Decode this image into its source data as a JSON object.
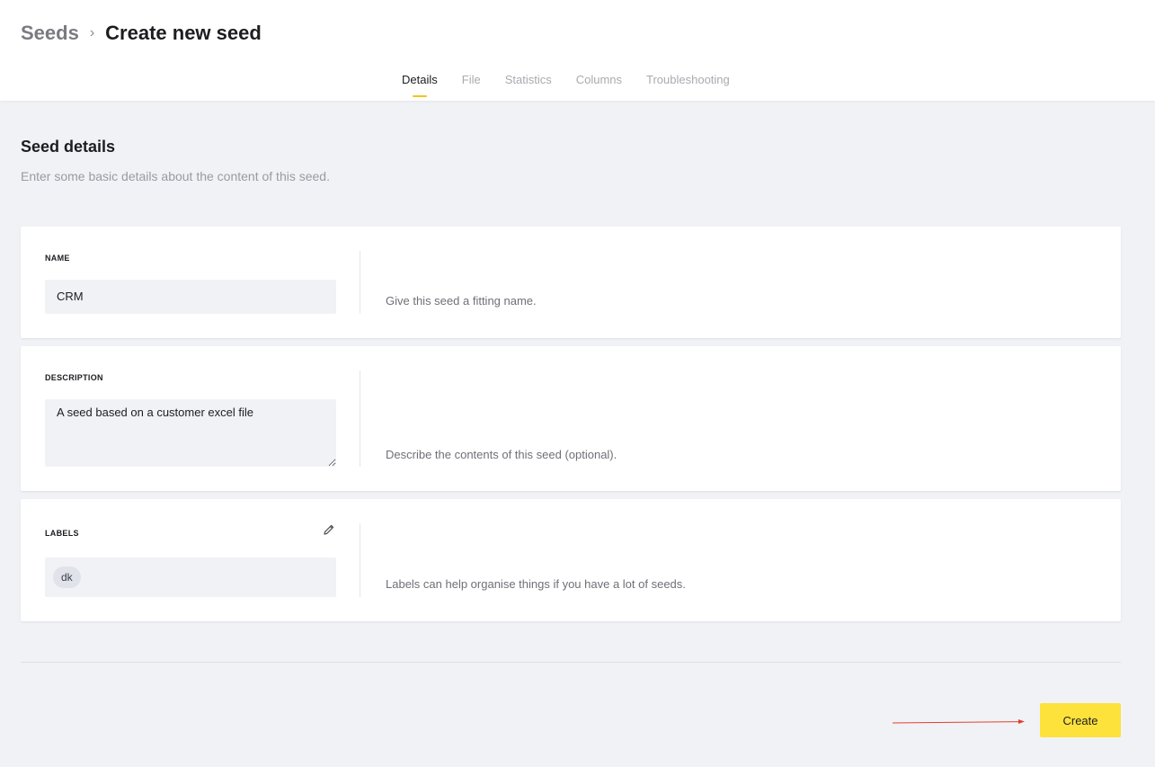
{
  "breadcrumb": {
    "root": "Seeds",
    "separator": "›",
    "current": "Create new seed"
  },
  "tabs": [
    {
      "label": "Details",
      "active": true
    },
    {
      "label": "File",
      "active": false
    },
    {
      "label": "Statistics",
      "active": false
    },
    {
      "label": "Columns",
      "active": false
    },
    {
      "label": "Troubleshooting",
      "active": false
    }
  ],
  "section": {
    "title": "Seed details",
    "subtitle": "Enter some basic details about the content of this seed."
  },
  "fields": {
    "name": {
      "label": "NAME",
      "value": "CRM",
      "help": "Give this seed a fitting name."
    },
    "description": {
      "label": "DESCRIPTION",
      "value": "A seed based on a customer excel file",
      "help": "Describe the contents of this seed (optional)."
    },
    "labels": {
      "label": "LABELS",
      "items": [
        "dk"
      ],
      "help": "Labels can help organise things if you have a lot of seeds.",
      "edit_icon": "pencil-icon"
    }
  },
  "actions": {
    "create_label": "Create"
  },
  "colors": {
    "accent": "#f5c518",
    "button": "#fde23c",
    "annotation_arrow": "#e0412b"
  }
}
